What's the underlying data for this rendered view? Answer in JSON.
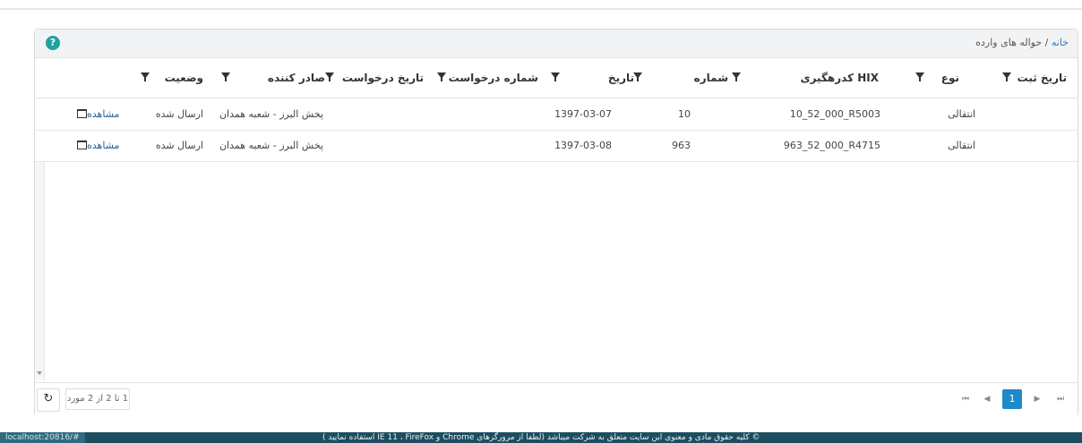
{
  "breadcrumb": {
    "home": "خانه",
    "separator": "/",
    "current": "حواله های وارده"
  },
  "help_icon_glyph": "?",
  "table": {
    "columns": [
      "تاریخ ثبت",
      "نوع",
      "کدرهگیری HIX",
      "شماره",
      "تاریخ",
      "شماره درخواست",
      "تاریخ درخواست",
      "صادر کننده",
      "وضعیت"
    ],
    "rows": [
      {
        "type": "انتقالی",
        "hix": "10_52_000_R5003",
        "number": "10",
        "date": "1397-03-07",
        "issuer": "پخش البرز - شعبه همدان",
        "status": "ارسال شده",
        "action": "مشاهده"
      },
      {
        "type": "انتقالی",
        "hix": "963_52_000_R4715",
        "number": "963",
        "date": "1397-03-08",
        "issuer": "پخش البرز - شعبه همدان",
        "status": "ارسال شده",
        "action": "مشاهده"
      }
    ]
  },
  "pager": {
    "first": "⏮",
    "prev": "◀",
    "current_page": "1",
    "next": "▶",
    "last": "⏭",
    "range_text": "1 تا 2 از 2 مورد",
    "refresh_glyph": "↻"
  },
  "statusbar": {
    "url": "localhost:20816/#",
    "copyright": "© کلیه حقوق مادی و معنوی این سایت متعلق به شرکت میباشد (لطفا از مرورگرهای Chrome و IE 11 ، FireFox استفاده نمایید )"
  },
  "colors": {
    "accent": "#1e88c8",
    "help": "#1aa3a0",
    "statusbar": "#1d4e5f"
  }
}
